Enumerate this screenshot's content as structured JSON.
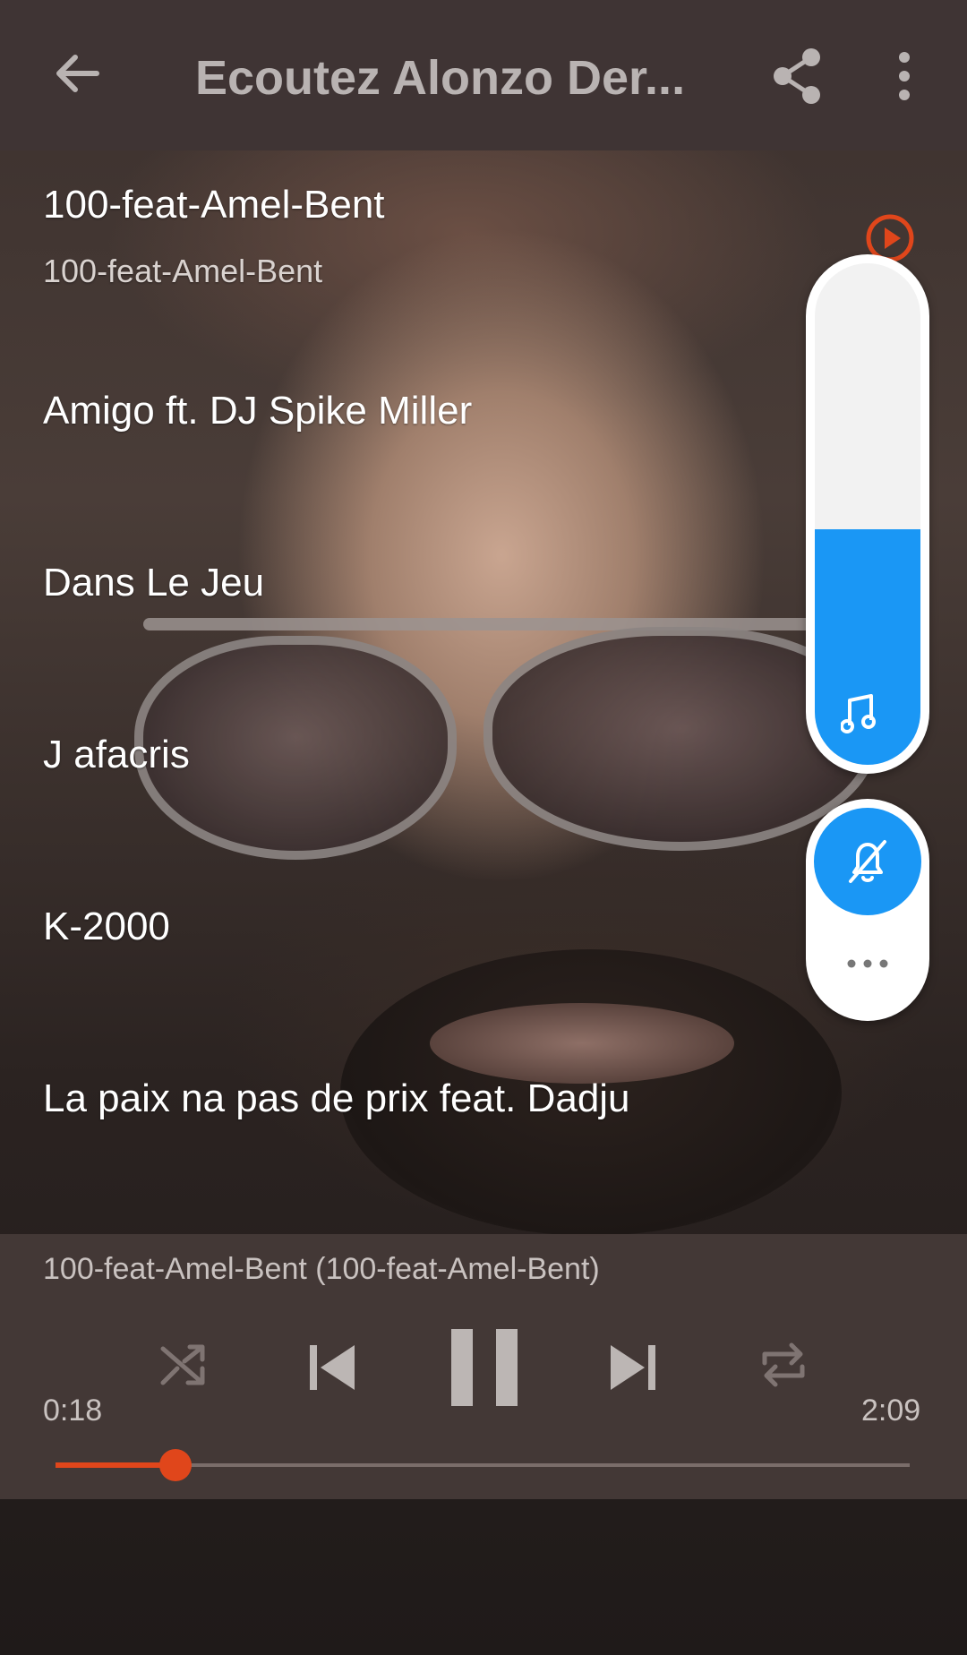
{
  "app_bar": {
    "title": "Ecoutez Alonzo Der...",
    "back_icon": "arrow-left-icon",
    "share_icon": "share-icon",
    "more_icon": "more-vert-icon"
  },
  "tracks": [
    {
      "title": "100-feat-Amel-Bent",
      "subtitle": "100-feat-Amel-Bent"
    },
    {
      "title": "Amigo ft. DJ Spike Miller"
    },
    {
      "title": "Dans Le Jeu"
    },
    {
      "title": "J afacris"
    },
    {
      "title": "K-2000"
    },
    {
      "title": "La paix na pas de prix feat. Dadju"
    }
  ],
  "volume_panel": {
    "level_fraction": 0.47,
    "fill_color": "#1a97f5",
    "slider_icon": "music-note-icon",
    "mute_icon": "bell-off-icon",
    "more_icon": "more-horiz-icon",
    "badge_icon": "play-circle-icon",
    "badge_color": "#e0461b"
  },
  "player": {
    "now_playing": "100-feat-Amel-Bent (100-feat-Amel-Bent)",
    "current_time": "0:18",
    "total_time": "2:09",
    "progress_fraction": 0.14,
    "accent_color": "#e0461b",
    "controls": {
      "shuffle_icon": "shuffle-icon",
      "previous_icon": "skip-previous-icon",
      "pause_icon": "pause-icon",
      "next_icon": "skip-next-icon",
      "repeat_icon": "repeat-icon"
    }
  }
}
